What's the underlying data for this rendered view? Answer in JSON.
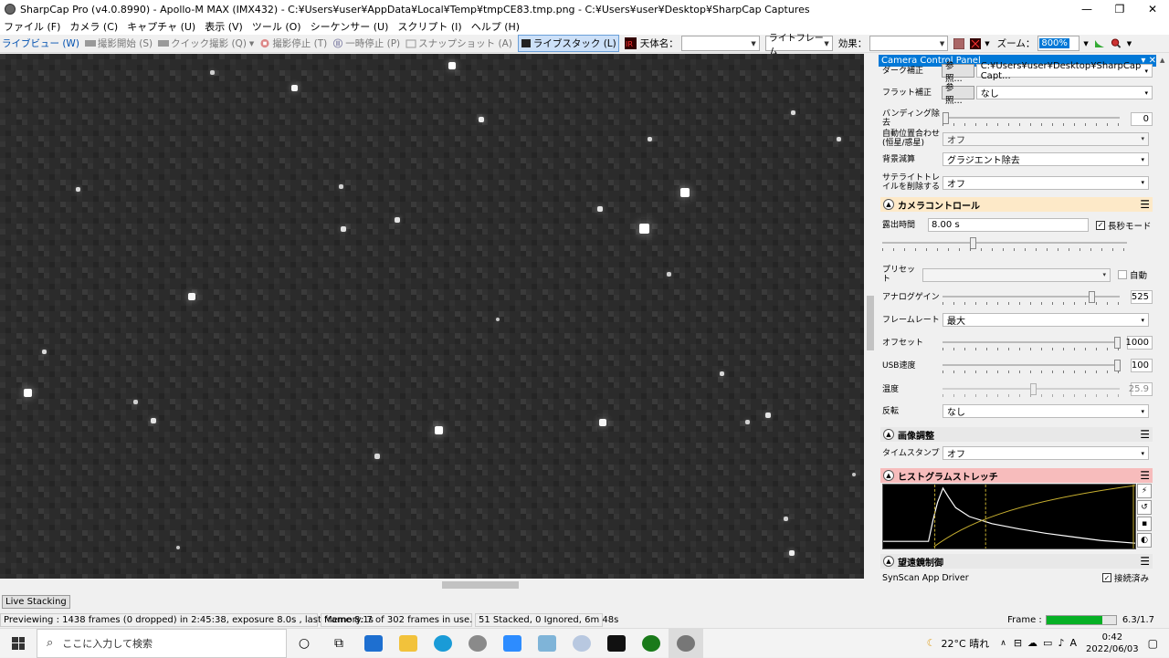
{
  "window": {
    "title": "SharpCap Pro (v4.0.8990) - Apollo-M MAX (IMX432) - C:¥Users¥user¥AppData¥Local¥Temp¥tmpCE83.tmp.png - C:¥Users¥user¥Desktop¥SharpCap Captures",
    "minimize": "—",
    "maximize": "❐",
    "close": "✕"
  },
  "menu": [
    "ファイル (F)",
    "カメラ (C)",
    "キャプチャ (U)",
    "表示 (V)",
    "ツール (O)",
    "シーケンサー (U)",
    "スクリプト (I)",
    "ヘルプ (H)"
  ],
  "toolbar": {
    "liveview": "ライブビュー (W)",
    "start_capture": "撮影開始 (S)",
    "quick_capture": "クイック撮影 (Q)",
    "stop_capture": "撮影停止 (T)",
    "pause": "一時停止 (P)",
    "snapshot": "スナップショット (A)",
    "livestack": "ライブスタック (L)",
    "target_label": "天体名：",
    "target_value": "",
    "frame_type": "ライトフレーム",
    "effect_label": "効果：",
    "effect_value": "",
    "zoom_label": "ズーム：",
    "zoom_value": "800%"
  },
  "panel": {
    "title": "Camera Control Panel",
    "dark_label": "ダーク補正",
    "dark_btn": "参照...",
    "dark_value": "C:¥Users¥user¥Desktop¥SharpCap Capt...",
    "flat_label": "フラット補正",
    "flat_btn": "参照...",
    "flat_value": "なし",
    "banding_label": "バンディング除去",
    "banding_value": "0",
    "align_label": "自動位置合わせ (恒星/惑星)",
    "align_value": "オフ",
    "bg_label": "背景減算",
    "bg_value": "グラジエント除去",
    "sat_label": "サテライトトレイルを削除する",
    "sat_value": "オフ",
    "camera_section": "カメラコントロール",
    "exposure_label": "露出時間",
    "exposure_value": "8.00 s",
    "longexp_label": "長秒モード",
    "preset_label": "プリセット",
    "auto_label": "自動",
    "gain_label": "アナログゲイン",
    "gain_value": "525",
    "framerate_label": "フレームレート",
    "framerate_value": "最大",
    "offset_label": "オフセット",
    "offset_value": "1000",
    "usb_label": "USB速度",
    "usb_value": "100",
    "temp_label": "温度",
    "temp_value": "25.9",
    "flip_label": "反転",
    "flip_value": "なし",
    "image_section": "画像調整",
    "timestamp_label": "タイムスタンプ",
    "timestamp_value": "オフ",
    "hist_section": "ヒストグラムストレッチ",
    "telescope_section": "望遠鏡制御",
    "driver_label": "SynScan App Driver",
    "connected_label": "接続済み"
  },
  "tabs": [
    "Live Stacking"
  ],
  "status": {
    "preview": "Previewing : 1438 frames (0 dropped) in 2:45:38, exposure 8.0s , last frame 8.1s",
    "memory": "Memory: 7 of 302 frames in use.",
    "stacked": "51 Stacked, 0 Ignored, 6m 48s",
    "frame_label": "Frame :",
    "frame_value": "6.3/1.7",
    "frame_progress": 0.8
  },
  "taskbar": {
    "search_placeholder": "ここに入力して検索",
    "weather": "22°C  晴れ",
    "ime": "A",
    "time": "0:42",
    "date": "2022/06/03"
  },
  "colors": {
    "accent": "#0078d7",
    "camera_section": "#fde9c8",
    "histogram_section": "#f7bcbc",
    "progress": "#06b025"
  }
}
